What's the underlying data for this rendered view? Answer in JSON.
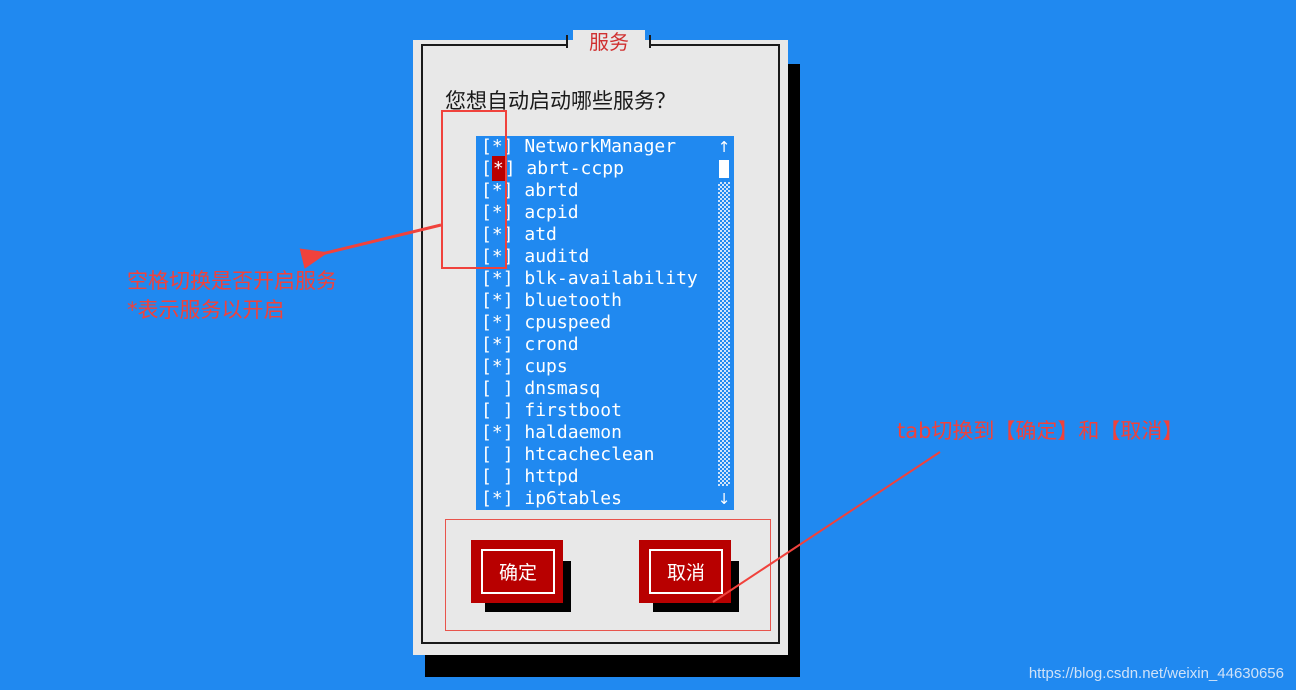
{
  "background_color": "#2089f0",
  "dialog": {
    "title": "服务",
    "heading": "您想自动启动哪些服务？",
    "services": [
      {
        "checked": true,
        "mark": "*",
        "name": "NetworkManager",
        "cursor": false
      },
      {
        "checked": true,
        "mark": "*",
        "name": "abrt-ccpp",
        "cursor": true
      },
      {
        "checked": true,
        "mark": "*",
        "name": "abrtd",
        "cursor": false
      },
      {
        "checked": true,
        "mark": "*",
        "name": "acpid",
        "cursor": false
      },
      {
        "checked": true,
        "mark": "*",
        "name": "atd",
        "cursor": false
      },
      {
        "checked": true,
        "mark": "*",
        "name": "auditd",
        "cursor": false
      },
      {
        "checked": true,
        "mark": "*",
        "name": "blk-availability",
        "cursor": false
      },
      {
        "checked": true,
        "mark": "*",
        "name": "bluetooth",
        "cursor": false
      },
      {
        "checked": true,
        "mark": "*",
        "name": "cpuspeed",
        "cursor": false
      },
      {
        "checked": true,
        "mark": "*",
        "name": "crond",
        "cursor": false
      },
      {
        "checked": true,
        "mark": "*",
        "name": "cups",
        "cursor": false
      },
      {
        "checked": false,
        "mark": " ",
        "name": "dnsmasq",
        "cursor": false
      },
      {
        "checked": false,
        "mark": " ",
        "name": "firstboot",
        "cursor": false
      },
      {
        "checked": true,
        "mark": "*",
        "name": "haldaemon",
        "cursor": false
      },
      {
        "checked": false,
        "mark": " ",
        "name": "htcacheclean",
        "cursor": false
      },
      {
        "checked": false,
        "mark": " ",
        "name": "httpd",
        "cursor": false
      },
      {
        "checked": true,
        "mark": "*",
        "name": "ip6tables",
        "cursor": false
      }
    ],
    "scrollbar": {
      "up_arrow": "↑",
      "down_arrow": "↓"
    },
    "buttons": {
      "ok_label": "确定",
      "cancel_label": "取消"
    }
  },
  "annotations": {
    "left_line1": "空格切换是否开启服务",
    "left_line2": "*表示服务以开启",
    "right_text": "tab切换到【确定】和【取消】",
    "color": "#f0423c"
  },
  "watermark": "https://blog.csdn.net/weixin_44630656"
}
